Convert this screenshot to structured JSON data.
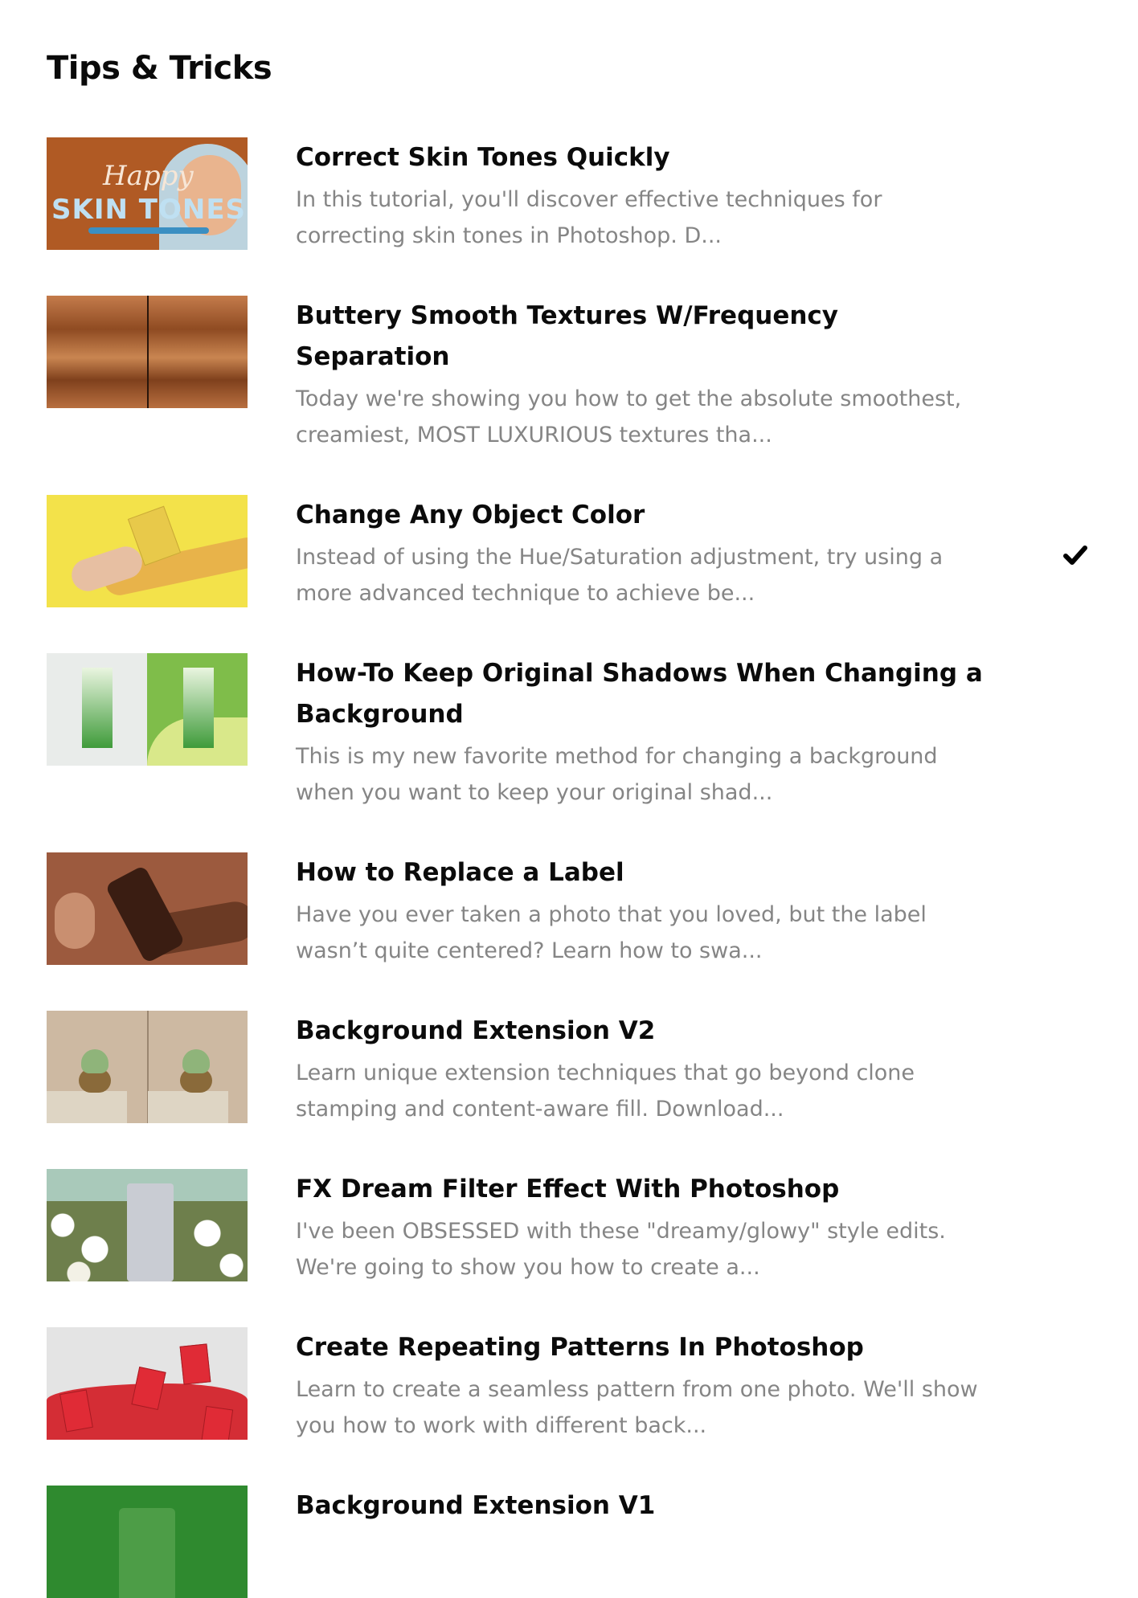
{
  "section_title": "Tips & Tricks",
  "items": [
    {
      "title": "Correct Skin Tones Quickly",
      "description": "In this tutorial, you'll discover effective techniques for correcting skin tones in Photoshop. D...",
      "thumb_text": {
        "line1": "Happy",
        "line2": "SKIN TONES"
      }
    },
    {
      "title": "Buttery Smooth Textures W/Frequency Separation",
      "description": "Today we're showing you how to get the absolute smoothest, creamiest, MOST LUXURIOUS textures tha..."
    },
    {
      "title": "Change Any Object Color",
      "description": "Instead of using the Hue/Saturation adjustment, try using a more advanced technique to achieve be...",
      "completed": true,
      "status_icon": "checkmark-icon"
    },
    {
      "title": "How-To Keep Original Shadows When Changing a Background",
      "description": "This is my new favorite method for changing a background when you want to keep your original shad..."
    },
    {
      "title": "How to Replace a Label",
      "description": "Have you ever taken a photo that you loved, but the label wasn’t quite centered? Learn how to swa..."
    },
    {
      "title": "Background Extension V2",
      "description": "Learn unique extension techniques that go beyond clone stamping and content-aware fill. Download..."
    },
    {
      "title": "FX Dream Filter Effect With Photoshop",
      "description": "I've been OBSESSED with these \"dreamy/glowy\" style edits. We're going to show you how to create a..."
    },
    {
      "title": "Create Repeating Patterns In Photoshop",
      "description": "Learn to create a seamless pattern from one photo. We'll show you how to work with different back..."
    },
    {
      "title": "Background Extension V1",
      "description": ""
    }
  ]
}
